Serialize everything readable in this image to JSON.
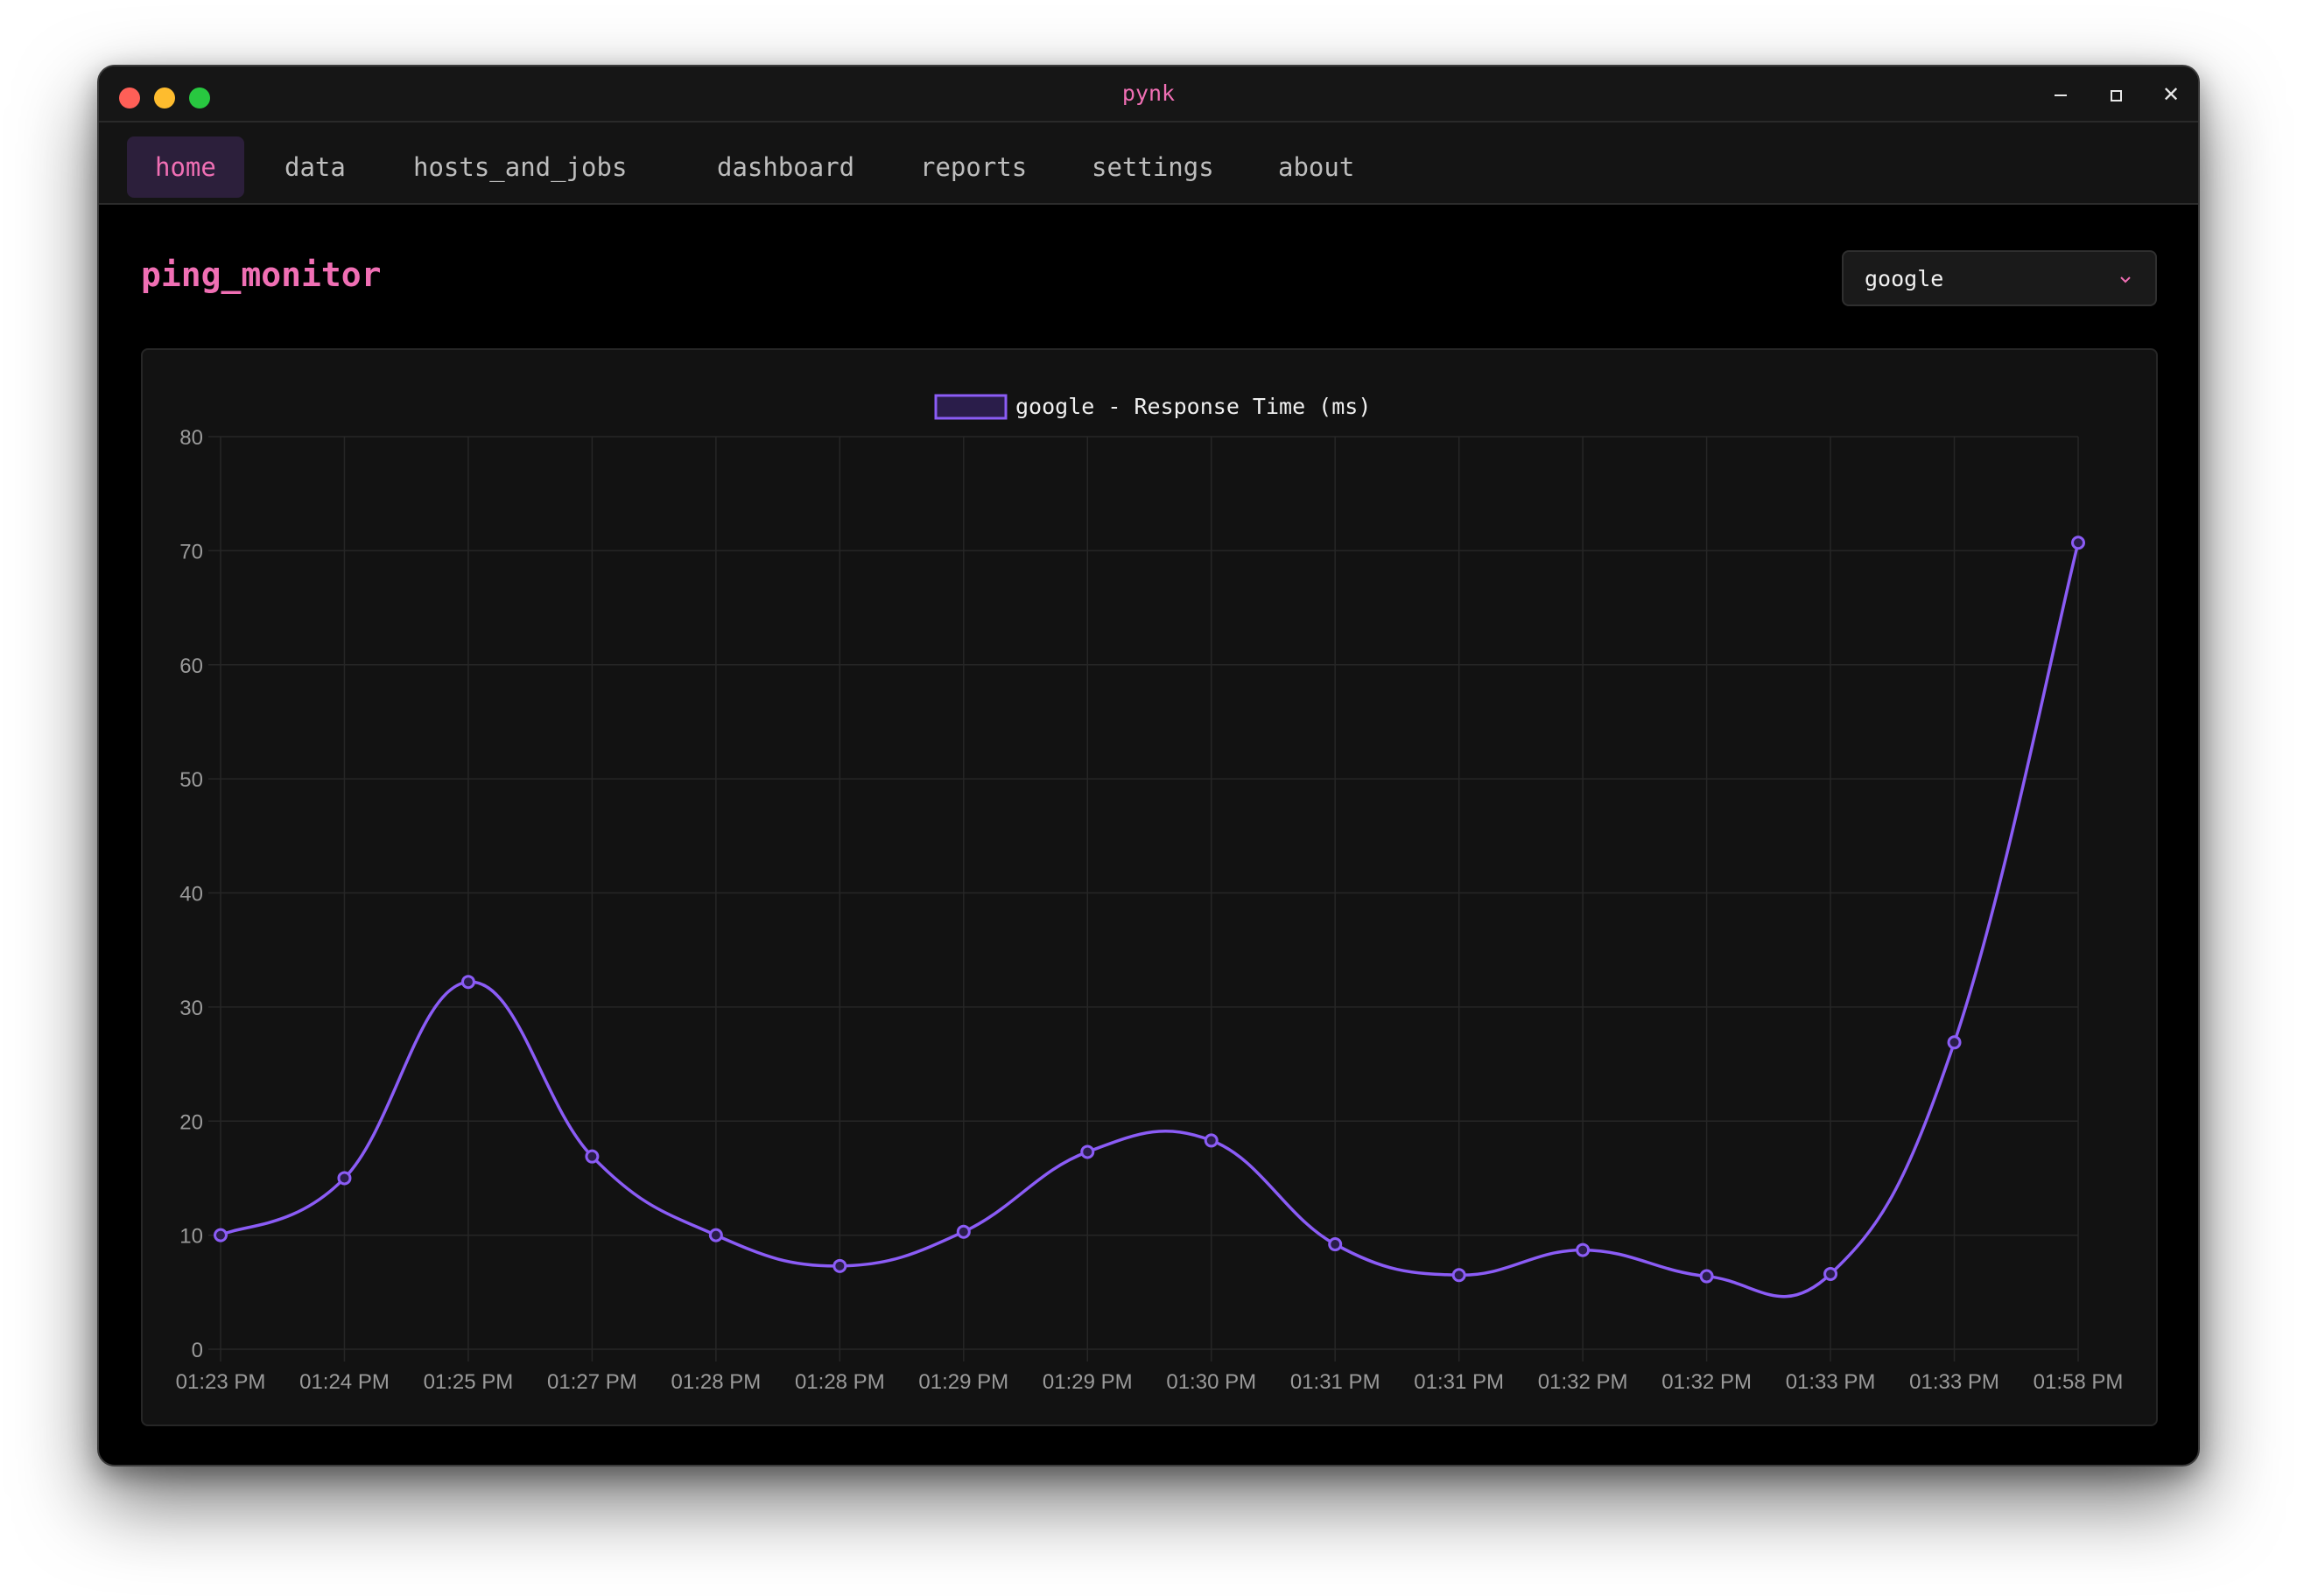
{
  "window": {
    "title": "pynk"
  },
  "nav": {
    "tabs": [
      {
        "label": "home",
        "active": true
      },
      {
        "label": "data"
      },
      {
        "label": "hosts_and_jobs"
      },
      {
        "label": "dashboard"
      },
      {
        "label": "reports"
      },
      {
        "label": "settings"
      },
      {
        "label": "about"
      }
    ]
  },
  "page": {
    "title": "ping_monitor"
  },
  "host_select": {
    "value": "google"
  },
  "colors": {
    "accent": "#f06fb4",
    "line": "#8b5cf6",
    "background": "#000000",
    "card": "#121212"
  },
  "chart_data": {
    "type": "line",
    "legend": "google - Response Time (ms)",
    "legend_position": "top-center",
    "grid": true,
    "ylim": [
      0,
      80
    ],
    "yticks": [
      0,
      10,
      20,
      30,
      40,
      50,
      60,
      70,
      80
    ],
    "categories": [
      "01:23 PM",
      "01:24 PM",
      "01:25 PM",
      "01:27 PM",
      "01:28 PM",
      "01:28 PM",
      "01:29 PM",
      "01:29 PM",
      "01:30 PM",
      "01:31 PM",
      "01:31 PM",
      "01:32 PM",
      "01:32 PM",
      "01:33 PM",
      "01:33 PM",
      "01:58 PM"
    ],
    "series": [
      {
        "name": "google - Response Time (ms)",
        "values": [
          10.0,
          15.0,
          32.2,
          16.9,
          10.0,
          7.3,
          10.3,
          17.3,
          18.3,
          9.2,
          6.5,
          8.7,
          6.4,
          6.6,
          26.9,
          70.7
        ]
      }
    ]
  }
}
